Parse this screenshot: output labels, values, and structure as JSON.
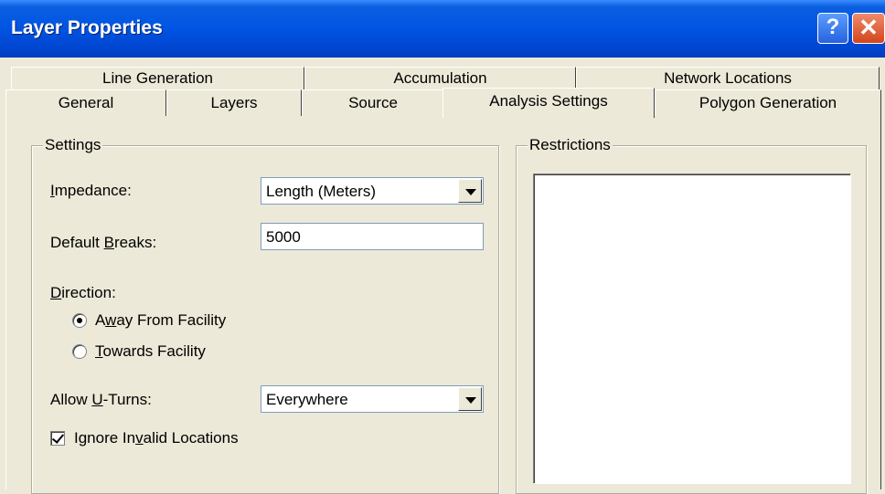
{
  "window": {
    "title": "Layer Properties",
    "help_icon": "?",
    "close_icon": "✕"
  },
  "tabs": {
    "row1": [
      "Line Generation",
      "Accumulation",
      "Network Locations"
    ],
    "row2": [
      "General",
      "Layers",
      "Source",
      "Analysis Settings",
      "Polygon Generation"
    ],
    "active": "Analysis Settings"
  },
  "settings": {
    "group_label": "Settings",
    "impedance": {
      "label_pre": "",
      "label_ul": "I",
      "label_post": "mpedance:",
      "value": "Length (Meters)"
    },
    "default_breaks": {
      "label_pre": "Default ",
      "label_ul": "B",
      "label_post": "reaks:",
      "value": "5000"
    },
    "direction": {
      "label_pre": "",
      "label_ul": "D",
      "label_post": "irection:",
      "away": {
        "pre": "A",
        "ul": "w",
        "post": "ay From Facility",
        "selected": true
      },
      "towards": {
        "pre": "",
        "ul": "T",
        "post": "owards Facility",
        "selected": false
      }
    },
    "uturns": {
      "label_pre": "Allow ",
      "label_ul": "U",
      "label_post": "-Turns:",
      "value": "Everywhere"
    },
    "ignore_invalid": {
      "pre": "Ignore In",
      "ul": "v",
      "post": "alid Locations",
      "checked": true
    }
  },
  "restrictions": {
    "group_label": "Restrictions"
  }
}
